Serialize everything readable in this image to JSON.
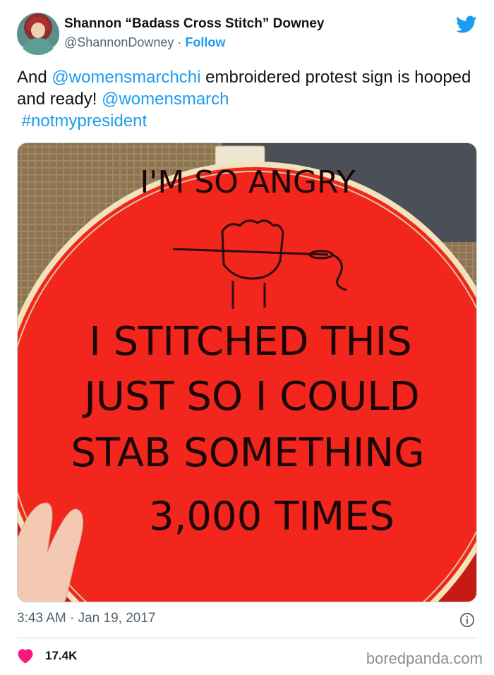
{
  "author": {
    "display_name": "Shannon “Badass Cross Stitch” Downey",
    "handle": "@ShannonDowney",
    "separator": "·",
    "follow_label": "Follow"
  },
  "tweet": {
    "text_1": "And ",
    "mention_1": "@womensmarchchi",
    "text_2": " embroidered protest sign is hooped and ready! ",
    "mention_2": "@womensmarch",
    "hashtag": "#notmypresident"
  },
  "media": {
    "embroidery_lines": [
      "I'M SO ANGRY",
      "I STITCHED THIS",
      "JUST SO I COULD",
      "STAB SOMETHING",
      "3,000 TIMES"
    ]
  },
  "meta": {
    "timestamp": "3:43 AM · Jan 19, 2017"
  },
  "engagement": {
    "likes": "17.4K"
  },
  "watermark": "boredpanda.com",
  "colors": {
    "accent": "#1d9bf0",
    "heart": "#f91880",
    "fabric": "#f2261d"
  }
}
